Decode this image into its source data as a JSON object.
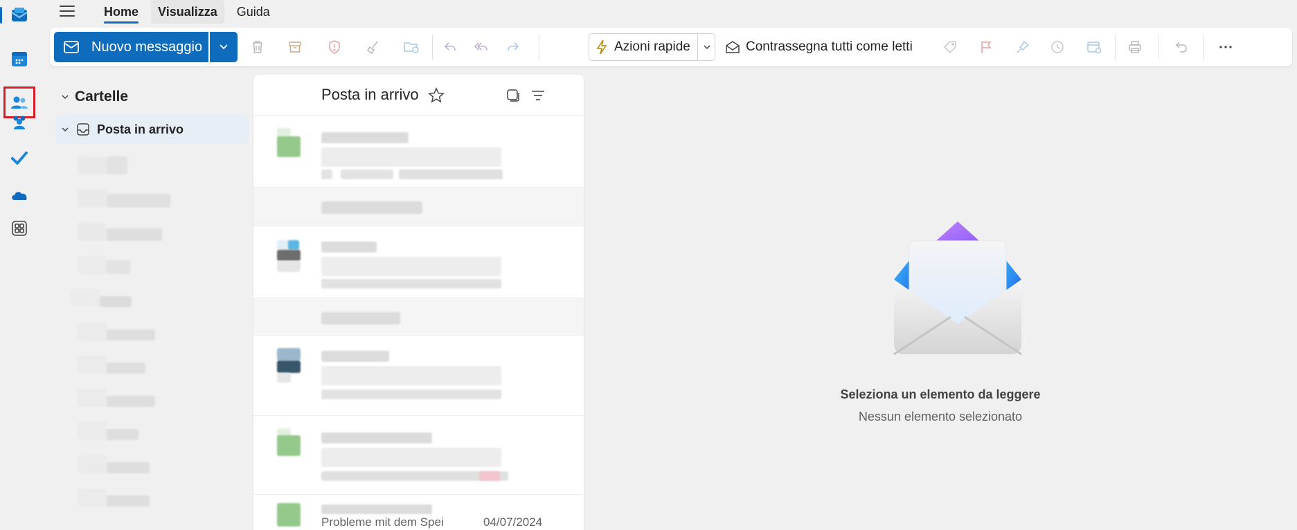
{
  "rail": {
    "items": [
      {
        "name": "mail-app"
      },
      {
        "name": "calendar-app"
      },
      {
        "name": "people-app"
      },
      {
        "name": "groups-app"
      },
      {
        "name": "todo-app"
      },
      {
        "name": "onedrive-app"
      },
      {
        "name": "more-apps"
      }
    ]
  },
  "tabs": [
    {
      "label": "Home"
    },
    {
      "label": "Visualizza"
    },
    {
      "label": "Guida"
    }
  ],
  "ribbon": {
    "new_message_label": "Nuovo messaggio",
    "quick_actions_label": "Azioni rapide",
    "mark_all_read_label": "Contrassegna tutti come letti",
    "accent_color": "#0f6cbd"
  },
  "folders": {
    "header": "Cartelle",
    "inbox_label": "Posta in arrivo"
  },
  "message_list": {
    "title": "Posta in arrivo",
    "partial_row_preview": "Probleme mit dem Spei",
    "partial_row_date": "04/07/2024"
  },
  "reading_pane": {
    "title": "Seleziona un elemento da leggere",
    "subtitle": "Nessun elemento selezionato"
  }
}
